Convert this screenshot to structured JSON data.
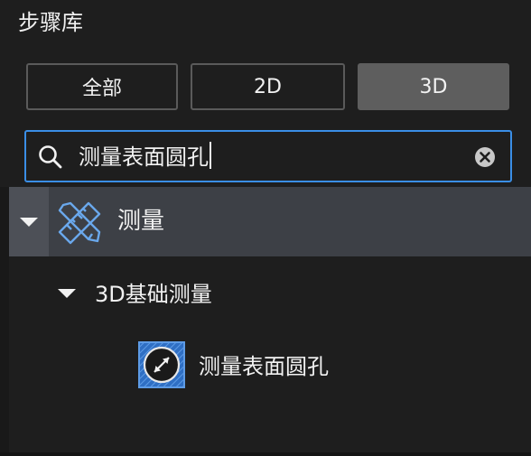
{
  "panel": {
    "title": "步骤库"
  },
  "filters": {
    "all_label": "全部",
    "d2_label": "2D",
    "d3_label": "3D",
    "active": "3D"
  },
  "search": {
    "value": "测量表面圆孔",
    "placeholder": ""
  },
  "tree": {
    "category": {
      "label": "测量",
      "icon": "ruler-pencil-icon",
      "expanded": true
    },
    "subcategory": {
      "label": "3D基础测量",
      "expanded": true
    },
    "item": {
      "label": "测量表面圆孔",
      "icon": "surface-hole-measure-icon"
    }
  },
  "colors": {
    "background": "#1e1e1e",
    "accent": "#3a8ee6",
    "active_button": "#5e5e5e",
    "selected_row": "#3d4046",
    "icon_blue": "#4a90e2"
  }
}
